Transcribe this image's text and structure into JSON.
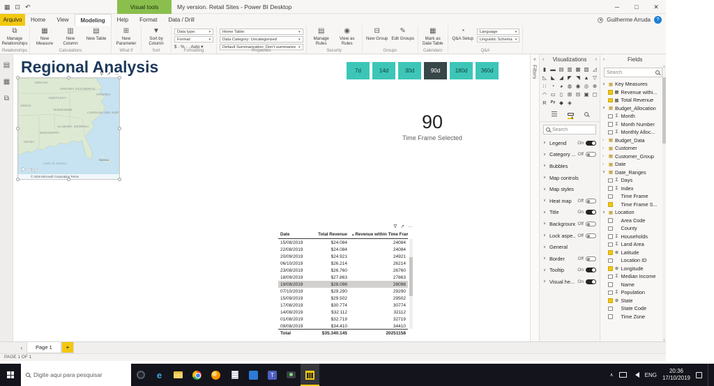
{
  "window": {
    "title": "My version. Retail Sites - Power BI Desktop",
    "contextual_tab_group": "Visual tools",
    "user": "Guilherme Arruda"
  },
  "icons": {
    "app": "▦",
    "save": "⊡",
    "undo": "↶",
    "minimize": "─",
    "maximize": "□",
    "close": "✕",
    "filter": "∇",
    "focus": "↗",
    "more": "…",
    "chevron_left": "‹",
    "chevron_right": "›",
    "chevron_down": "∨",
    "chevron_up": "∧",
    "collapse": "«",
    "sort_asc": "▲",
    "sigma": "Σ",
    "globe": "⊕",
    "measure": "▦",
    "table": "▦",
    "help": "?"
  },
  "ribbon": {
    "file_tab": "Arquivo",
    "tabs": [
      "Home",
      "View",
      "Modeling",
      "Help"
    ],
    "active_tab": "Modeling",
    "contextual_tabs": [
      "Format",
      "Data / Drill"
    ],
    "groups": [
      {
        "label": "Relationships",
        "items": [
          {
            "t": "big",
            "label": "Manage Relationships",
            "glyph": "⧉"
          }
        ]
      },
      {
        "label": "Calculations",
        "items": [
          {
            "t": "big",
            "label": "New Measure",
            "glyph": "▦"
          },
          {
            "t": "big",
            "label": "New Column",
            "glyph": "▥"
          },
          {
            "t": "big",
            "label": "New Table",
            "glyph": "▤"
          }
        ]
      },
      {
        "label": "What If",
        "items": [
          {
            "t": "big",
            "label": "New Parameter",
            "glyph": "⊞"
          }
        ]
      },
      {
        "label": "Sort",
        "items": [
          {
            "t": "big",
            "label": "Sort by Column",
            "glyph": "▼"
          }
        ]
      },
      {
        "label": "Formatting",
        "items": [
          {
            "t": "dd",
            "label": "Data type:"
          },
          {
            "t": "dd",
            "label": "Format:"
          },
          {
            "t": "text",
            "label": "$ · % ·  ,   Auto ▾"
          }
        ]
      },
      {
        "label": "Properties",
        "items": [
          {
            "t": "dd",
            "label": "Home Table:"
          },
          {
            "t": "dd",
            "label": "Data Category: Uncategorized"
          },
          {
            "t": "dd",
            "label": "Default Summarization: Don't summarize"
          }
        ]
      },
      {
        "label": "Security",
        "items": [
          {
            "t": "big",
            "label": "Manage Rules",
            "glyph": "▤"
          },
          {
            "t": "big",
            "label": "View as Rules",
            "glyph": "◉"
          }
        ]
      },
      {
        "label": "Groups",
        "items": [
          {
            "t": "big",
            "label": "New Group",
            "glyph": "⊟"
          },
          {
            "t": "big",
            "label": "Edit Groups",
            "glyph": "✎"
          }
        ]
      },
      {
        "label": "Calendars",
        "items": [
          {
            "t": "big",
            "label": "Mark as Date Table",
            "glyph": "▦"
          }
        ]
      },
      {
        "label": "Q&A",
        "items": [
          {
            "t": "big",
            "label": "Q&A Setup",
            "glyph": "◔"
          },
          {
            "t": "dd",
            "label": "Language"
          },
          {
            "t": "dd",
            "label": "Linguistic Schema"
          }
        ]
      }
    ]
  },
  "canvas": {
    "report_title": "Regional Analysis",
    "slicer": {
      "options": [
        "7d",
        "14d",
        "30d",
        "90d",
        "180d",
        "360d"
      ],
      "selected": "90d"
    },
    "card": {
      "value": "90",
      "label": "Time Frame Selected"
    },
    "map": {
      "labels": [
        "INDIANA",
        "VIRGINIA OCCIDENTAL",
        "VIRGINIA",
        "KENTUCKY",
        "TENNESSEE",
        "CAROLINA DEL NORTE",
        "ANSAS",
        "MISSISSIPPI",
        "ALABAMA",
        "GEORGIA",
        "ISIANA",
        "Golfo de México",
        "Nassau"
      ],
      "logo": "Bing",
      "attribution": "© 2019 Microsoft Corporation Terms"
    },
    "table": {
      "columns": [
        "Date",
        "Total Revenue",
        "Revenue within Time Frame"
      ],
      "rows": [
        [
          "15/08/2019",
          "$24.084",
          "24084"
        ],
        [
          "22/08/2019",
          "$24.084",
          "24084"
        ],
        [
          "20/09/2019",
          "$24.921",
          "24921"
        ],
        [
          "06/10/2019",
          "$26.214",
          "26214"
        ],
        [
          "23/08/2019",
          "$26.760",
          "26760"
        ],
        [
          "18/09/2019",
          "$27.863",
          "27863"
        ],
        [
          "19/08/2019",
          "$28.098",
          "28098"
        ],
        [
          "07/10/2019",
          "$29.290",
          "29290"
        ],
        [
          "15/09/2019",
          "$29.502",
          "29502"
        ],
        [
          "17/08/2019",
          "$30.774",
          "30774"
        ],
        [
          "14/08/2019",
          "$32.112",
          "32112"
        ],
        [
          "01/08/2019",
          "$32.719",
          "32719"
        ],
        [
          "09/08/2019",
          "$34.410",
          "34410"
        ]
      ],
      "selected_row_index": 6,
      "total": [
        "Total",
        "$35.340.145",
        "20251158"
      ]
    }
  },
  "filters_pane": {
    "label": "Filters"
  },
  "viz_pane": {
    "header": "Visualizations",
    "search_placeholder": "Search",
    "visual_icons": [
      {
        "name": "stacked-bar-chart",
        "glyph": "▮"
      },
      {
        "name": "stacked-column-chart",
        "glyph": "▬"
      },
      {
        "name": "clustered-bar-chart",
        "glyph": "▤"
      },
      {
        "name": "clustered-column-chart",
        "glyph": "▥"
      },
      {
        "name": "100-stacked-bar-chart",
        "glyph": "▦"
      },
      {
        "name": "100-stacked-column-chart",
        "glyph": "▧"
      },
      {
        "name": "line-chart",
        "glyph": "◿"
      },
      {
        "name": "area-chart",
        "glyph": "◺"
      },
      {
        "name": "stacked-area-chart",
        "glyph": "◣"
      },
      {
        "name": "line-and-stacked-column-chart",
        "glyph": "◢"
      },
      {
        "name": "line-and-clustered-column-chart",
        "glyph": "◤"
      },
      {
        "name": "ribbon-chart",
        "glyph": "◥"
      },
      {
        "name": "waterfall-chart",
        "glyph": "▲"
      },
      {
        "name": "funnel-chart",
        "glyph": "▽"
      },
      {
        "name": "scatter-chart",
        "glyph": "∷"
      },
      {
        "name": "pie-chart",
        "glyph": "◔"
      },
      {
        "name": "donut-chart",
        "glyph": "◕"
      },
      {
        "name": "treemap",
        "glyph": "◍"
      },
      {
        "name": "map",
        "glyph": "◉"
      },
      {
        "name": "filled-map",
        "glyph": "◎"
      },
      {
        "name": "shape-map",
        "glyph": "⊕"
      },
      {
        "name": "gauge",
        "glyph": "◠"
      },
      {
        "name": "card",
        "glyph": "▭"
      },
      {
        "name": "multi-row-card",
        "glyph": "▯"
      },
      {
        "name": "kpi",
        "glyph": "⊞"
      },
      {
        "name": "slicer",
        "glyph": "⊟"
      },
      {
        "name": "table",
        "glyph": "▣"
      },
      {
        "name": "matrix",
        "glyph": "▢"
      },
      {
        "name": "r-script-visual",
        "glyph": "R"
      },
      {
        "name": "python-visual",
        "glyph": "Py"
      },
      {
        "name": "key-influencers",
        "glyph": "◆"
      },
      {
        "name": "qa-visual",
        "glyph": "◈"
      }
    ],
    "format_options": [
      {
        "label": "Legend",
        "state": "On"
      },
      {
        "label": "Category ...",
        "state": "Off"
      },
      {
        "label": "Bubbles",
        "state": ""
      },
      {
        "label": "Map controls",
        "state": ""
      },
      {
        "label": "Map styles",
        "state": ""
      },
      {
        "label": "Heat map",
        "state": "Off"
      },
      {
        "label": "Title",
        "state": "On"
      },
      {
        "label": "Background",
        "state": "Off"
      },
      {
        "label": "Lock aspe...",
        "state": "Off"
      },
      {
        "label": "General",
        "state": ""
      },
      {
        "label": "Border",
        "state": "Off"
      },
      {
        "label": "Tooltip",
        "state": "On"
      },
      {
        "label": "Visual he...",
        "state": "On"
      }
    ]
  },
  "fields_pane": {
    "header": "Fields",
    "search_placeholder": "Search",
    "tree": [
      {
        "label": "Key Measures",
        "type": "table",
        "expanded": true
      },
      {
        "label": "Revenue withi...",
        "type": "field",
        "icon": "measure",
        "checked": true
      },
      {
        "label": "Total Revenue",
        "type": "field",
        "icon": "measure",
        "checked": true
      },
      {
        "label": "Budget_Allocation",
        "type": "table",
        "expanded": true
      },
      {
        "label": "Month",
        "type": "field",
        "icon": "sigma",
        "checked": false
      },
      {
        "label": "Month Number",
        "type": "field",
        "icon": "sigma",
        "checked": false
      },
      {
        "label": "Monthly Alloc...",
        "type": "field",
        "icon": "sigma",
        "checked": false
      },
      {
        "label": "Budget_Data",
        "type": "table",
        "expanded": false
      },
      {
        "label": "Customer",
        "type": "table",
        "expanded": false
      },
      {
        "label": "Customer_Group",
        "type": "table",
        "expanded": false
      },
      {
        "label": "Date",
        "type": "table",
        "expanded": false
      },
      {
        "label": "Date_Ranges",
        "type": "table",
        "expanded": true
      },
      {
        "label": "Days",
        "type": "field",
        "icon": "sigma",
        "checked": false
      },
      {
        "label": "Index",
        "type": "field",
        "icon": "sigma",
        "checked": false
      },
      {
        "label": "Time Frame",
        "type": "field",
        "icon": "none",
        "checked": false
      },
      {
        "label": "Time Frame S...",
        "type": "field",
        "icon": "none",
        "checked": true
      },
      {
        "label": "Location",
        "type": "table",
        "expanded": true
      },
      {
        "label": "Area Code",
        "type": "field",
        "icon": "none",
        "checked": false
      },
      {
        "label": "County",
        "type": "field",
        "icon": "none",
        "checked": false
      },
      {
        "label": "Households",
        "type": "field",
        "icon": "sigma",
        "checked": false
      },
      {
        "label": "Land Area",
        "type": "field",
        "icon": "sigma",
        "checked": false
      },
      {
        "label": "Latitude",
        "type": "field",
        "icon": "globe",
        "checked": true
      },
      {
        "label": "Location ID",
        "type": "field",
        "icon": "none",
        "checked": false
      },
      {
        "label": "Longitude",
        "type": "field",
        "icon": "globe",
        "checked": true
      },
      {
        "label": "Median Income",
        "type": "field",
        "icon": "sigma",
        "checked": false
      },
      {
        "label": "Name",
        "type": "field",
        "icon": "none",
        "checked": false
      },
      {
        "label": "Population",
        "type": "field",
        "icon": "sigma",
        "checked": false
      },
      {
        "label": "State",
        "type": "field",
        "icon": "globe",
        "checked": true
      },
      {
        "label": "State Code",
        "type": "field",
        "icon": "none",
        "checked": false
      },
      {
        "label": "Time Zone",
        "type": "field",
        "icon": "none",
        "checked": false
      }
    ]
  },
  "pages": {
    "tabs": [
      "Page 1"
    ],
    "active": "Page 1",
    "add_label": "+"
  },
  "status_bar": {
    "text": "PAGE 1 OF 1"
  },
  "taskbar": {
    "search_placeholder": "Digite aqui para pesquisar",
    "apps": [
      "cortana",
      "edge",
      "file-explorer",
      "chrome",
      "firefox",
      "notepad",
      "visual-studio",
      "teams",
      "camera",
      "power-bi"
    ],
    "active_app": "power-bi",
    "tray": {
      "language": "ENG",
      "time": "20:36",
      "date": "17/10/2019"
    }
  }
}
